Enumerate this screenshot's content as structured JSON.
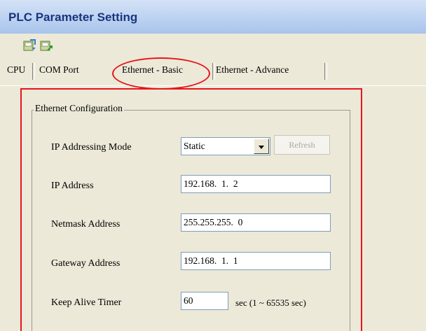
{
  "window": {
    "title": "PLC Parameter Setting"
  },
  "toolbar": {
    "buttons": [
      {
        "icon": "import-icon"
      },
      {
        "icon": "export-icon"
      }
    ]
  },
  "tabs": [
    {
      "label": "CPU"
    },
    {
      "label": "COM Port"
    },
    {
      "label": "Ethernet - Basic",
      "selected": true
    },
    {
      "label": "Ethernet - Advance"
    }
  ],
  "group": {
    "title": "Ethernet Configuration",
    "ip_mode": {
      "label": "IP Addressing Mode",
      "value": "Static",
      "refresh_label": "Refresh"
    },
    "ip_address": {
      "label": "IP Address",
      "value": "192.168.  1.  2"
    },
    "netmask": {
      "label": "Netmask Address",
      "value": "255.255.255.  0"
    },
    "gateway": {
      "label": "Gateway Address",
      "value": "192.168.  1.  1"
    },
    "keep_alive": {
      "label": "Keep Alive Timer",
      "value": "60",
      "unit": "sec (1 ~ 65535 sec)"
    }
  },
  "highlight": {
    "color": "#e8141c"
  }
}
